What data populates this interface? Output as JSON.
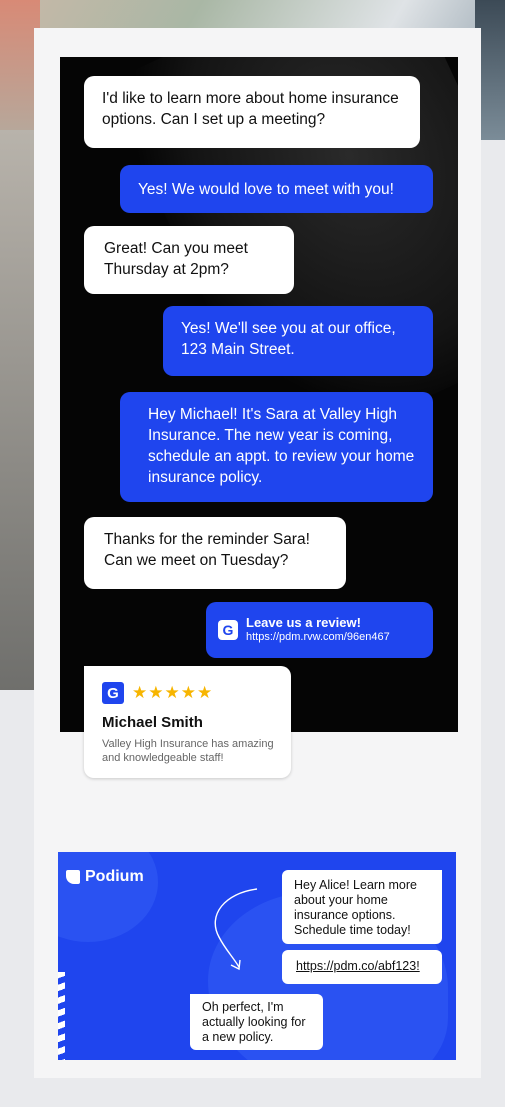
{
  "chat": {
    "messages": [
      {
        "side": "in",
        "text": "I'd like to learn more about home insurance options. Can I set up a meeting?"
      },
      {
        "side": "out",
        "text": "Yes! We would love to meet with you!"
      },
      {
        "side": "in",
        "text": "Great! Can you meet Thursday at 2pm?"
      },
      {
        "side": "out",
        "text": "Yes! We'll see you at our office, 123 Main Street."
      },
      {
        "side": "out",
        "text": "Hey Michael! It's Sara at Valley High Insurance. The new year is coming, schedule an appt. to review your home insurance policy."
      },
      {
        "side": "in",
        "text": "Thanks for the reminder Sara! Can we meet on Tuesday?"
      }
    ],
    "review_link": {
      "icon": "google-icon",
      "badge": "G",
      "title": "Leave us a review!",
      "url": "https://pdm.rvw.com/96en467"
    },
    "review_card": {
      "badge": "G",
      "stars": "★★★★★",
      "rating": 5,
      "name": "Michael Smith",
      "quote": "Valley High Insurance has amazing and knowledgeable staff!"
    }
  },
  "podium": {
    "logo": "Podium",
    "bubbles": [
      {
        "text": "Hey Alice! Learn more about your home insurance options. Schedule time today!"
      },
      {
        "text": "https://pdm.co/abf123!"
      },
      {
        "text": "Oh perfect, I'm actually looking for a new policy."
      }
    ]
  },
  "colors": {
    "brand_blue": "#1f45ee",
    "star_gold": "#f7b500",
    "chat_background": "#050505"
  }
}
